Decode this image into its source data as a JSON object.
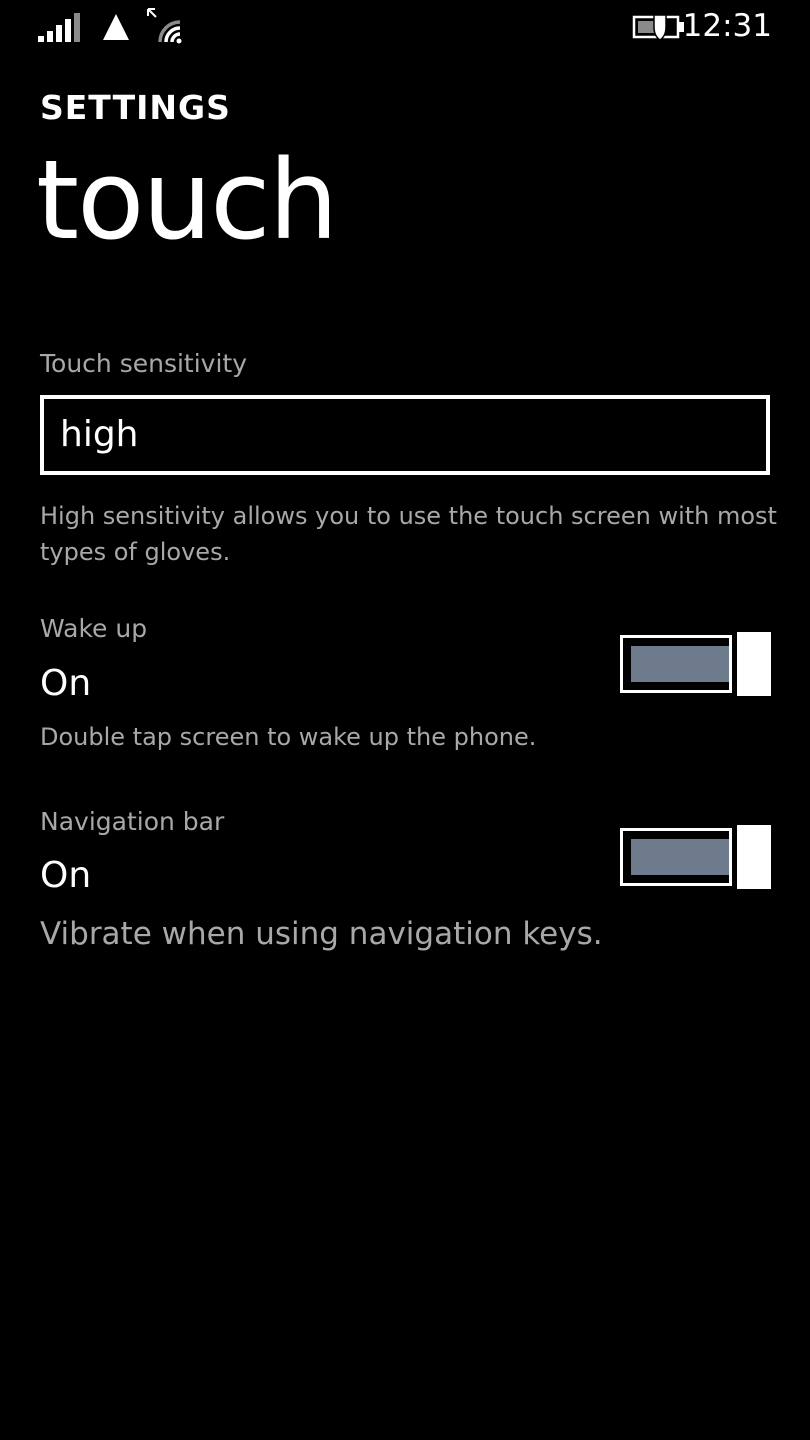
{
  "status_bar": {
    "time": "12:31",
    "icons": [
      "signal-strength-icon",
      "data-connection-icon",
      "wifi-icon",
      "battery-saver-icon"
    ]
  },
  "header": {
    "app_title": "SETTINGS",
    "page_title": "touch"
  },
  "touch_sensitivity": {
    "label": "Touch sensitivity",
    "value": "high",
    "help": "High sensitivity allows you to use the touch screen with most types of gloves."
  },
  "wake_up": {
    "label": "Wake up",
    "state": "On",
    "help": "Double tap screen to wake up the phone."
  },
  "navigation_bar": {
    "label": "Navigation bar",
    "state": "On",
    "help": "Vibrate when using navigation keys."
  },
  "colors": {
    "background": "#000000",
    "text": "#ffffff",
    "secondary_text": "#a8a8a8",
    "toggle_fill": "#6e7b8d"
  }
}
